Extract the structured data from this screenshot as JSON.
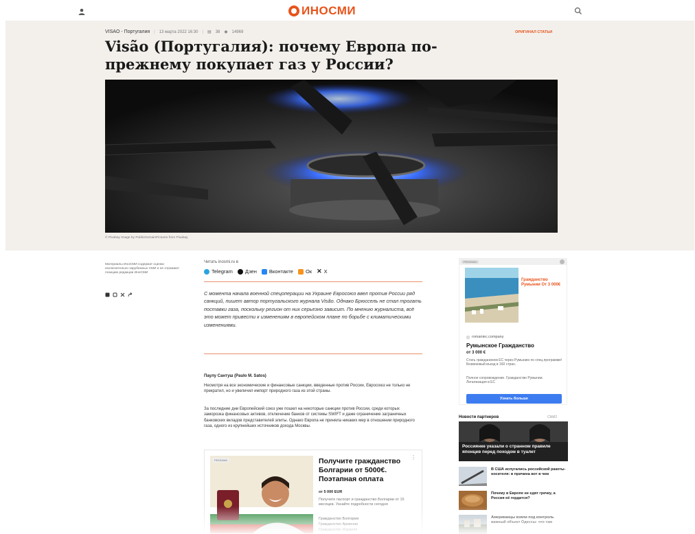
{
  "header": {
    "logo_text": "ИНОСМИ",
    "brand_color": "#e8531a"
  },
  "article": {
    "source": "VISAO - Португалия",
    "date": "13 марта 2022 16:30",
    "comments": "38",
    "views": "14969",
    "original_label": "ОРИГИНАЛ СТАТЬИ",
    "title": "Visão (Португалия): почему Европа по-прежнему покупает газ у России?",
    "photo_caption": "© Pixabay Image by PublicDomainPictures from Pixabay",
    "disclaimer": "Материалы ИноСМИ содержат оценки исключительно зарубежных СМИ и не отражают позицию редакции ИноСМИ",
    "read_label": "Читать inosmi.ru в",
    "socials": [
      "Telegram",
      "Дзен",
      "Вконтакте",
      "Ок",
      "X"
    ],
    "lead": "С момента начала военной спецоперации на Украине Евросоюз ввел против России ряд санкций, пишет автор португальского журнала Visão. Однако Брюссель не стал трогать поставки газа, поскольку регион от них серьезно зависит. По мнению журналиста, всё это может привести к изменениям в европейском плане по борьбе с климатическими изменениями.",
    "author": "Паулу Сантуш (Paulo M. Satos)",
    "paragraphs": [
      "Несмотря на все экономические и финансовые санкции, введенные против России, Евросоюз не только не прекратил, но и увеличил импорт природного газа из этой страны.",
      "За последние дни Европейский союз уже пошел на некоторые санкции против России, среди которых заморозка финансовых активов, отключение банков от системы SWIFT и даже ограничение заграничных банковских вкладов представителей элиты. Однако Европа не приняла никаких мер в отношении природного газа, одного из крупнейших источников дохода Москвы."
    ]
  },
  "inline_ad": {
    "tag": "РЕКЛАМА",
    "headline": "Получите гражданство Болгарии от 5000€. Поэтапная оплата",
    "price": "от 5 000 EUR",
    "description": "Получите паспорт и гражданство Болгарии от 15 месяцев. Узнайте подробности сегодня",
    "links": [
      "Гражданство Болгарии",
      "Гражданство Армении",
      "Гражданство Израиля"
    ]
  },
  "side_ad": {
    "tag": "РЕКЛАМА",
    "image_text": "Гражданство Румынии От 3 000€",
    "domain": "romaniec.company",
    "headline": "Румынское Гражданство",
    "price": "от 3 000 €",
    "desc1": "Стать гражданином ЕС через Румынию по спец.программе! Безвизовый въезд в 160 стран.",
    "desc2": "Полное сопровождение. Гражданство Румынии. Легализация в ЕС",
    "button": "Узнать больше"
  },
  "partner_news": {
    "heading": "Новости партнеров",
    "brand": "СМИ2",
    "main_title": "Россиянке указали о странном правиле японцев перед походом в туалет",
    "items": [
      "В США испугались российской ракеты-носителя: в причина вот в чем",
      "Почему в Европе не едят гречку, а Россия её гордится?",
      "Американцы взяли под контроль важный объект Одессы: что там"
    ]
  }
}
